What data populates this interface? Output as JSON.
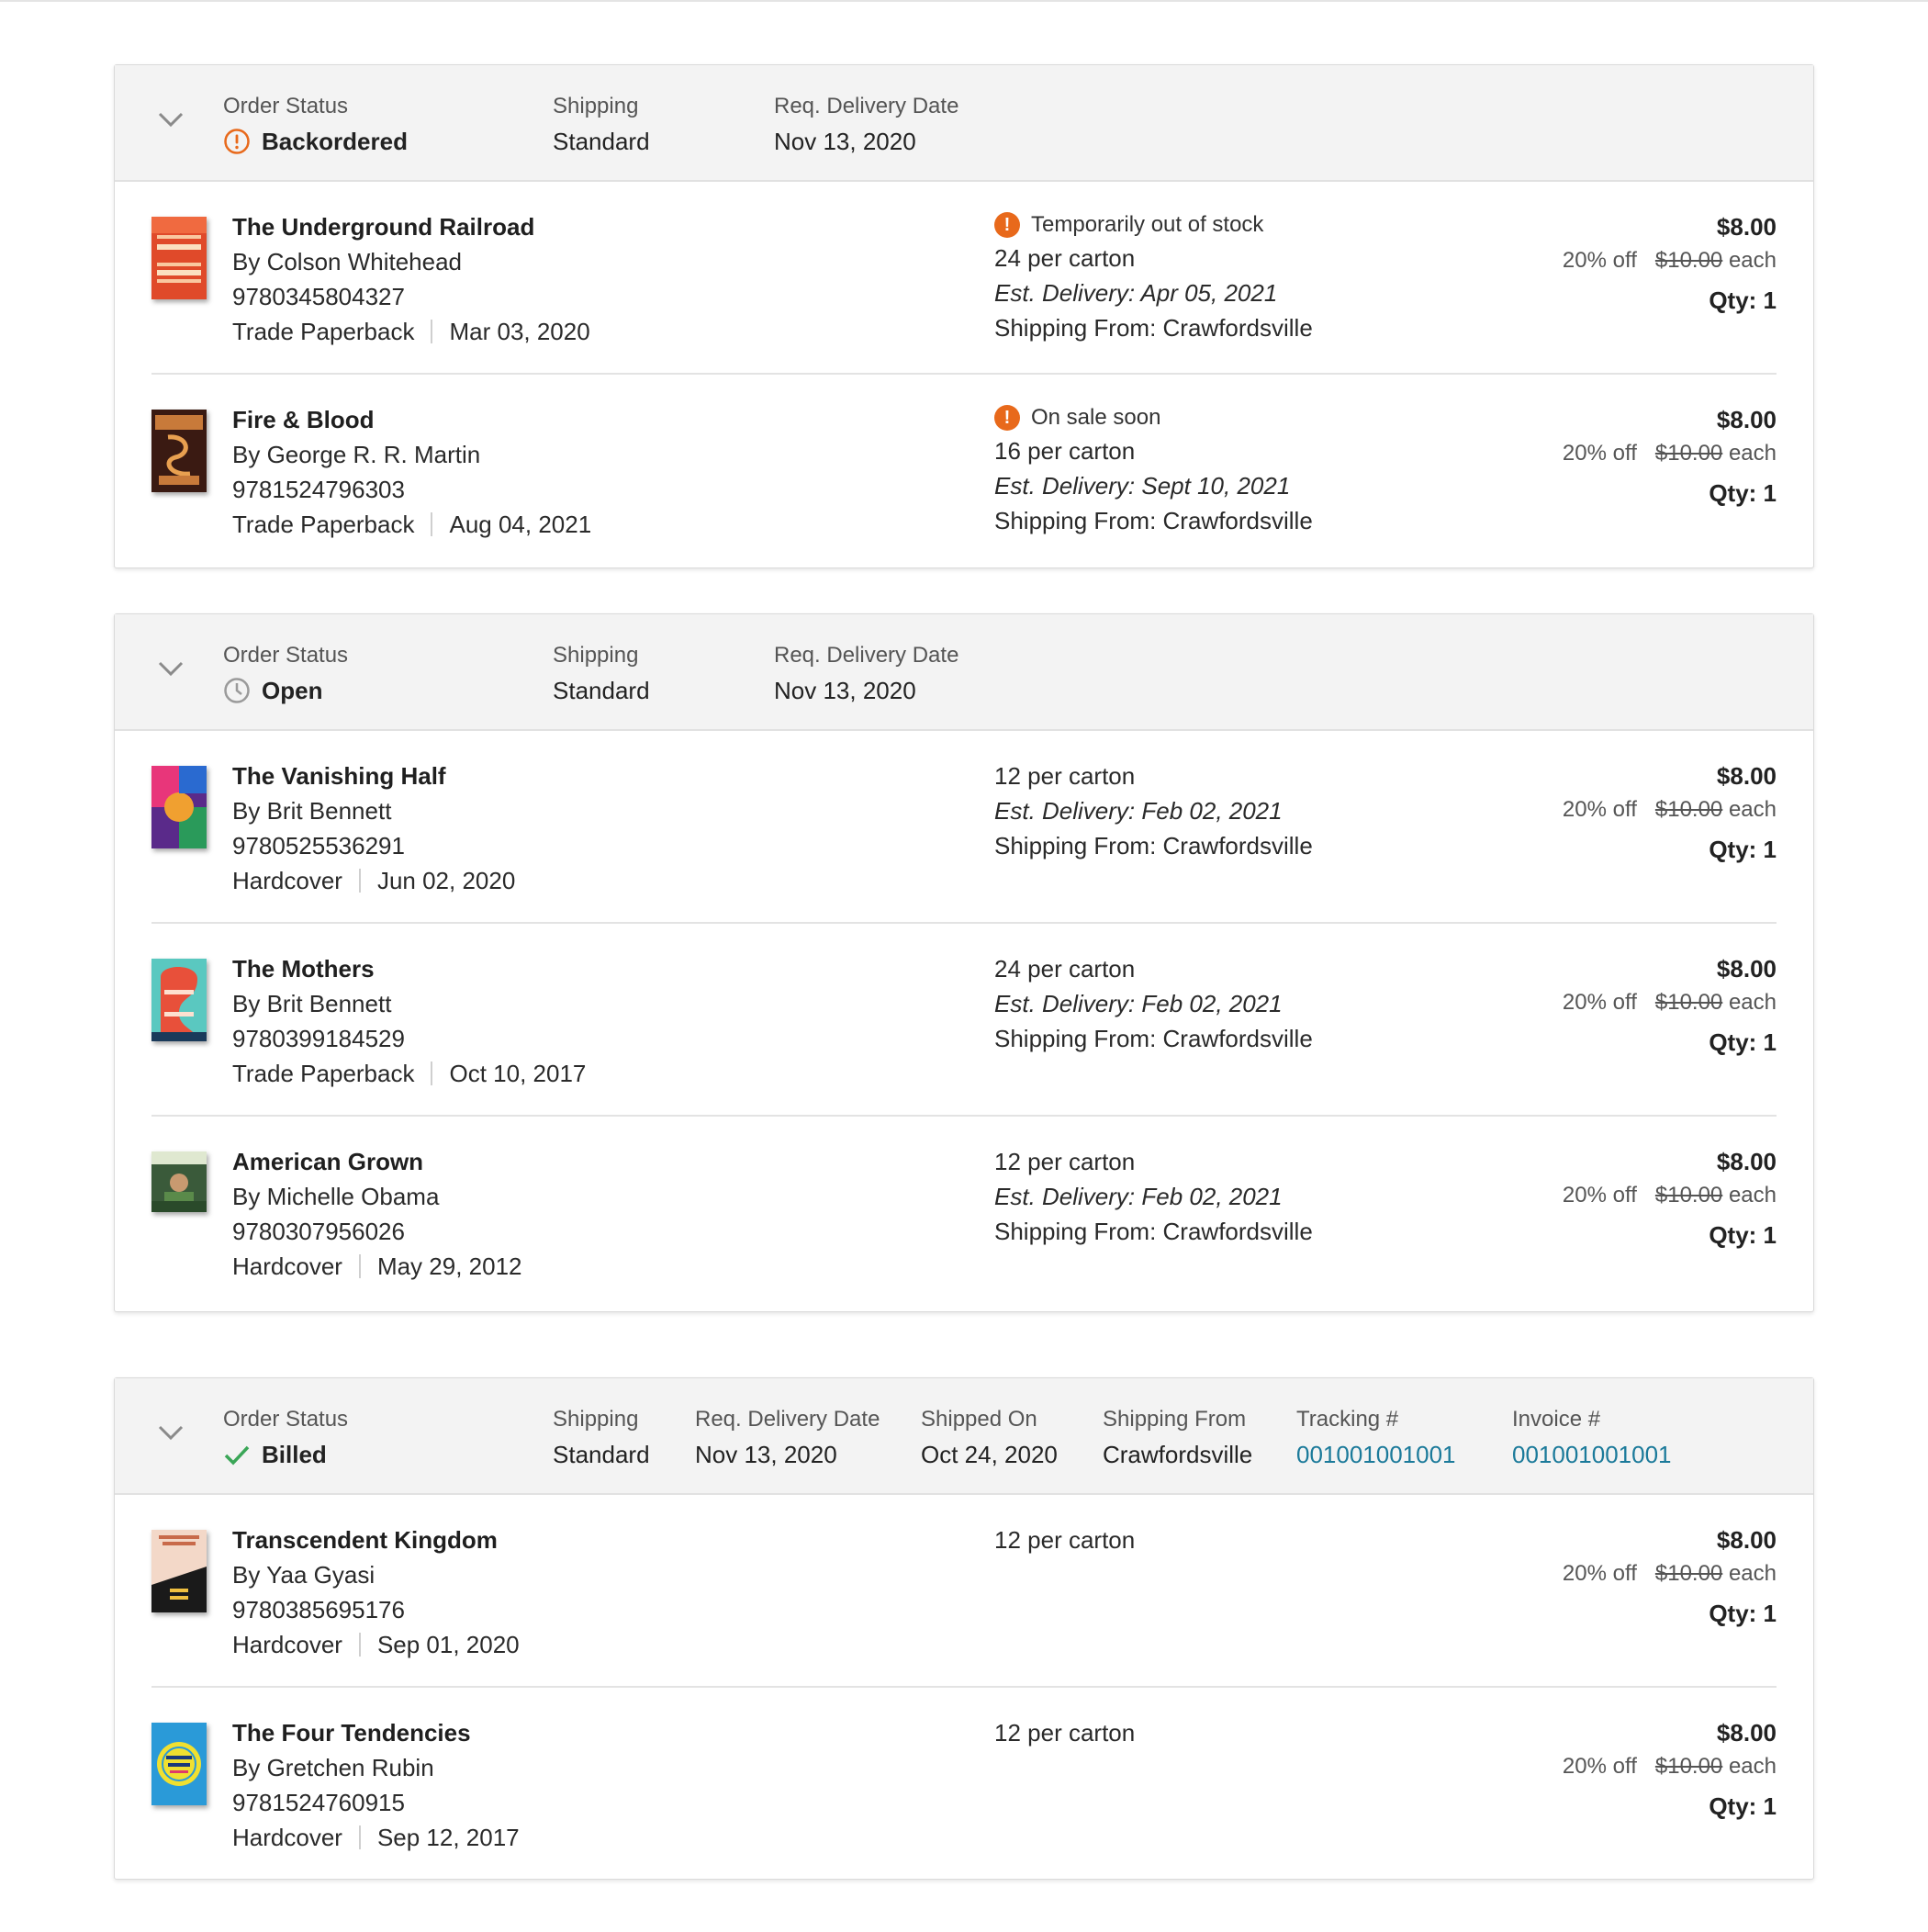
{
  "orders": [
    {
      "header": {
        "status_label": "Order Status",
        "status_value": "Backordered",
        "shipping_label": "Shipping",
        "shipping_value": "Standard",
        "req_label": "Req. Delivery Date",
        "req_value": "Nov 13, 2020"
      },
      "items": [
        {
          "title": "The Underground Railroad",
          "author": "By Colson Whitehead",
          "isbn": "9780345804327",
          "format": "Trade Paperback",
          "pub_date": "Mar 03, 2020",
          "notice": "Temporarily out of stock",
          "carton": "24 per carton",
          "est_delivery": "Est. Delivery: Apr 05, 2021",
          "ship_from": "Shipping From: Crawfordsville",
          "price": "$8.00",
          "discount": "20% off",
          "orig_price": "$10.00",
          "each": "each",
          "qty": "Qty: 1"
        },
        {
          "title": "Fire & Blood",
          "author": "By George R. R. Martin",
          "isbn": "9781524796303",
          "format": "Trade Paperback",
          "pub_date": "Aug 04, 2021",
          "notice": "On sale soon",
          "carton": "16 per carton",
          "est_delivery": "Est. Delivery: Sept 10, 2021",
          "ship_from": "Shipping From: Crawfordsville",
          "price": "$8.00",
          "discount": "20% off",
          "orig_price": "$10.00",
          "each": "each",
          "qty": "Qty: 1"
        }
      ]
    },
    {
      "header": {
        "status_label": "Order Status",
        "status_value": "Open",
        "shipping_label": "Shipping",
        "shipping_value": "Standard",
        "req_label": "Req. Delivery Date",
        "req_value": "Nov 13, 2020"
      },
      "items": [
        {
          "title": "The Vanishing Half",
          "author": "By Brit Bennett",
          "isbn": "9780525536291",
          "format": "Hardcover",
          "pub_date": "Jun 02, 2020",
          "carton": "12 per carton",
          "est_delivery": "Est. Delivery: Feb 02, 2021",
          "ship_from": "Shipping From: Crawfordsville",
          "price": "$8.00",
          "discount": "20% off",
          "orig_price": "$10.00",
          "each": "each",
          "qty": "Qty: 1"
        },
        {
          "title": "The Mothers",
          "author": "By Brit Bennett",
          "isbn": "9780399184529",
          "format": "Trade Paperback",
          "pub_date": "Oct 10, 2017",
          "carton": "24 per carton",
          "est_delivery": "Est. Delivery: Feb 02, 2021",
          "ship_from": "Shipping From: Crawfordsville",
          "price": "$8.00",
          "discount": "20% off",
          "orig_price": "$10.00",
          "each": "each",
          "qty": "Qty: 1"
        },
        {
          "title": "American Grown",
          "author": "By Michelle Obama",
          "isbn": "9780307956026",
          "format": "Hardcover",
          "pub_date": "May 29, 2012",
          "carton": "12 per carton",
          "est_delivery": "Est. Delivery: Feb 02, 2021",
          "ship_from": "Shipping From: Crawfordsville",
          "price": "$8.00",
          "discount": "20% off",
          "orig_price": "$10.00",
          "each": "each",
          "qty": "Qty: 1"
        }
      ]
    },
    {
      "header": {
        "status_label": "Order Status",
        "status_value": "Billed",
        "shipping_label": "Shipping",
        "shipping_value": "Standard",
        "req_label": "Req. Delivery Date",
        "req_value": "Nov 13, 2020",
        "shipped_label": "Shipped On",
        "shipped_value": "Oct 24, 2020",
        "from_label": "Shipping From",
        "from_value": "Crawfordsville",
        "tracking_label": "Tracking #",
        "tracking_value": "001001001001",
        "invoice_label": "Invoice #",
        "invoice_value": "001001001001"
      },
      "items": [
        {
          "title": "Transcendent Kingdom",
          "author": "By Yaa Gyasi",
          "isbn": "9780385695176",
          "format": "Hardcover",
          "pub_date": "Sep 01, 2020",
          "carton": "12 per carton",
          "price": "$8.00",
          "discount": "20% off",
          "orig_price": "$10.00",
          "each": "each",
          "qty": "Qty: 1"
        },
        {
          "title": "The Four Tendencies",
          "author": "By Gretchen Rubin",
          "isbn": "9781524760915",
          "format": "Hardcover",
          "pub_date": "Sep 12, 2017",
          "carton": "12 per carton",
          "price": "$8.00",
          "discount": "20% off",
          "orig_price": "$10.00",
          "each": "each",
          "qty": "Qty: 1"
        }
      ]
    }
  ],
  "colors": {
    "warning": "#e8691b",
    "success": "#3aa657",
    "link": "#1b7a9a",
    "header_bg": "#f3f3f3"
  },
  "icons": {
    "chevron": "chevron-down-icon",
    "backordered": "exclamation-circle-icon",
    "open": "clock-icon",
    "billed": "checkmark-icon",
    "notice": "alert-icon"
  }
}
